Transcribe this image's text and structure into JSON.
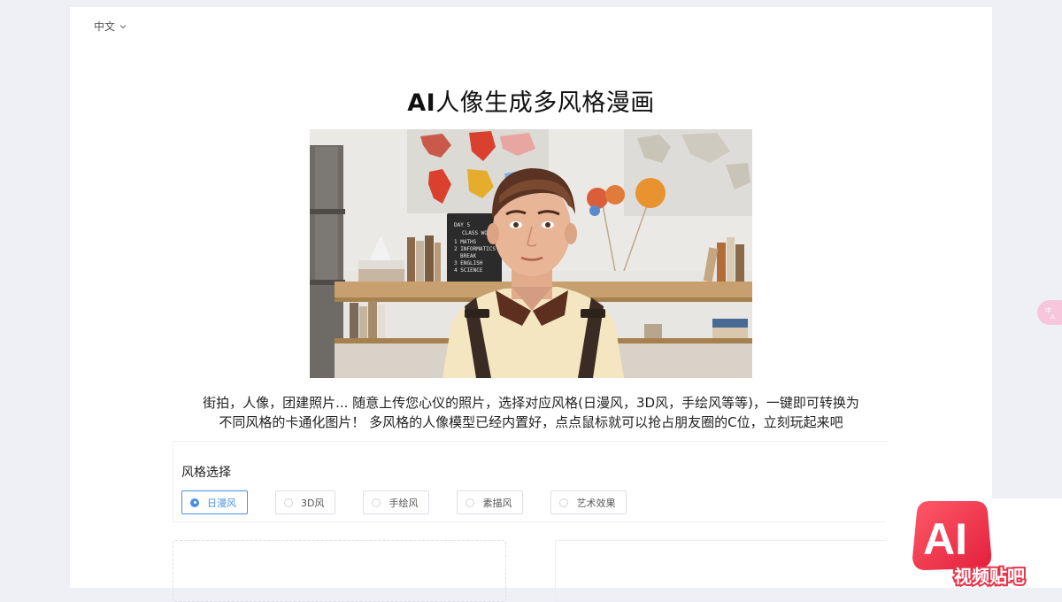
{
  "header": {
    "language": "中文"
  },
  "page": {
    "title_prefix": "AI",
    "title_rest": "人像生成多风格漫画",
    "description_line1": "街拍，人像，团建照片... 随意上传您心仪的照片，选择对应风格(日漫风，3D风，手绘风等等)，一键即可转换为",
    "description_line2": "不同风格的卡通化图片！ 多风格的人像模型已经内置好，点点鼠标就可以抢占朋友圈的C位，立刻玩起来吧"
  },
  "hero": {
    "chalkboard": [
      "DAY 5",
      "CLASS WORK",
      "1 MATHS",
      "2 INFORMATICS",
      "BREAK",
      "3 ENGLISH",
      "4 SCIENCE"
    ]
  },
  "style_select": {
    "label": "风格选择",
    "selected": "日漫风",
    "options": [
      "日漫风",
      "3D风",
      "手绘风",
      "素描风",
      "艺术效果"
    ]
  },
  "watermark": {
    "logo": "AI",
    "text": "视频贴吧"
  },
  "colors": {
    "accent": "#4a90e2",
    "page_bg": "#eef0f6",
    "watermark_red": "#f03a4a"
  },
  "icons": {
    "language_toggle": "chevron-down-icon",
    "translate": "translate-icon"
  }
}
